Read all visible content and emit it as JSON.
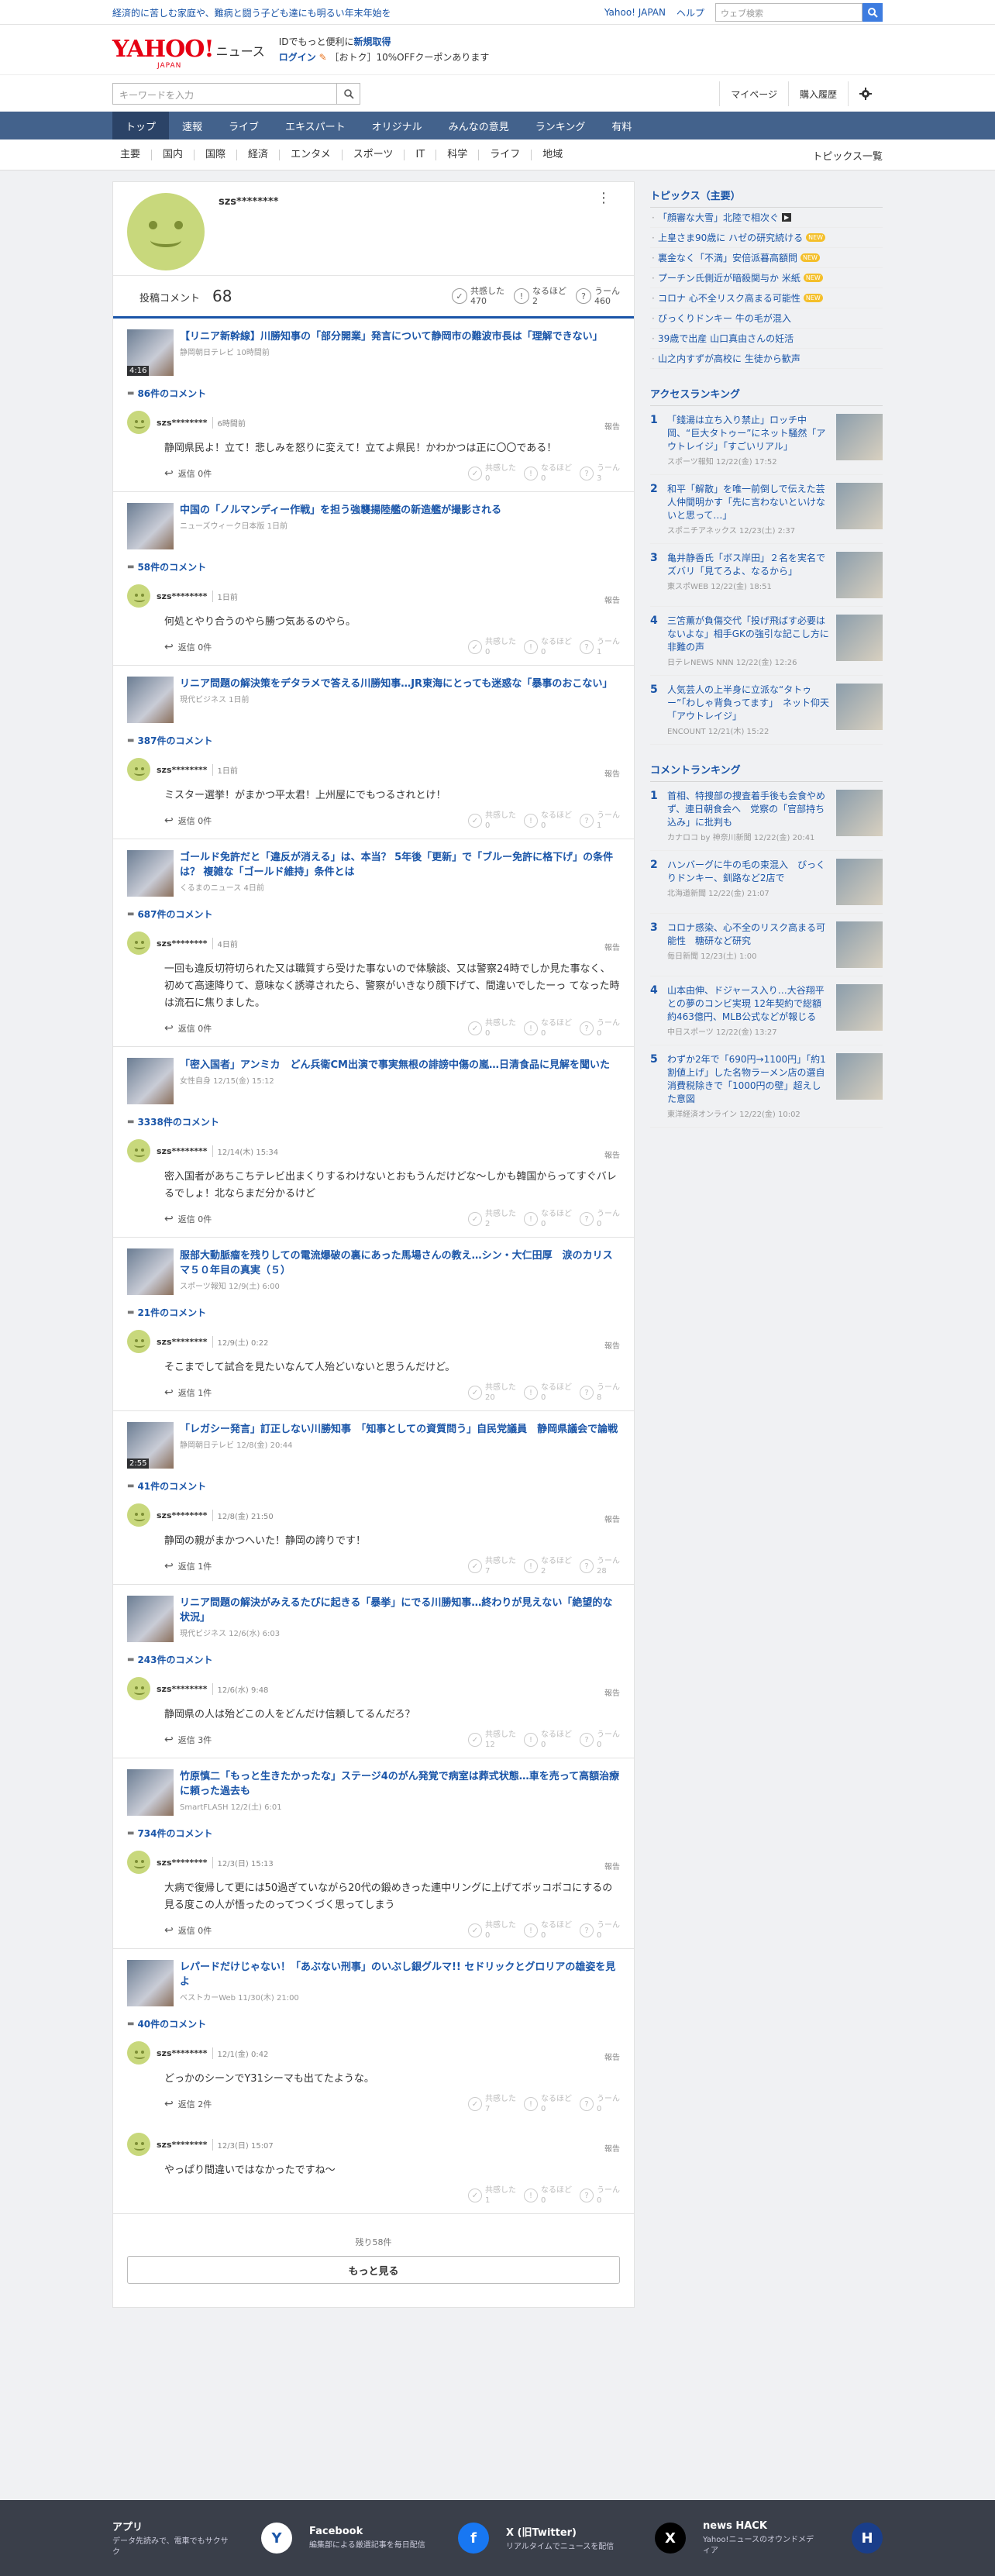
{
  "topbar": {
    "promo": "経済的に苦しむ家庭や、難病と闘う子ども達にも明るい年末年始を",
    "yahoo_japan": "Yahoo! JAPAN",
    "help": "ヘルプ",
    "search_placeholder": "ウェブ検索"
  },
  "header": {
    "logo": "YAHOO!",
    "logo_sub": "JAPAN",
    "logo_news": "ニュース",
    "login_promo_1": "IDでもっと便利に",
    "login_promo_1_link": "新規取得",
    "login_promo_2_link": "ログイン",
    "login_promo_2": "［おトク］10%OFFクーポンあります"
  },
  "searchrow": {
    "placeholder": "キーワードを入力",
    "mypage": "マイページ",
    "subscription": "購入履歴"
  },
  "nav": {
    "tabs": [
      "トップ",
      "速報",
      "ライブ",
      "エキスパート",
      "オリジナル",
      "みんなの意見",
      "ランキング",
      "有料"
    ]
  },
  "subnav": {
    "items": [
      "主要",
      "国内",
      "国際",
      "経済",
      "エンタメ",
      "スポーツ",
      "IT",
      "科学",
      "ライフ",
      "地域"
    ],
    "all": "トピックス一覧"
  },
  "profile": {
    "name": "szs********",
    "post_label": "投稿コメント",
    "post_count": "68",
    "reacts": [
      {
        "label": "共感した",
        "count": "470",
        "icon": "✓"
      },
      {
        "label": "なるほど",
        "count": "2",
        "icon": "!"
      },
      {
        "label": "うーん",
        "count": "460",
        "icon": "?"
      }
    ]
  },
  "articles": [
    {
      "title": "【リニア新幹線】川勝知事の「部分開業」発言について静岡市の難波市長は「理解できない」",
      "source": "静岡朝日テレビ 10時間前",
      "duration": "4:16",
      "comments": "86件のコメント",
      "items": [
        {
          "user": "szs********",
          "time": "6時間前",
          "body": "静岡県民よ！立て！悲しみを怒りに変えて！立てよ県民！かわかつは正に〇〇である！",
          "reply": "返信 0件",
          "r": [
            "0",
            "0",
            "3"
          ]
        }
      ]
    },
    {
      "title": "中国の「ノルマンディー作戦」を担う強襲揚陸艦の新造艦が撮影される",
      "source": "ニューズウィーク日本版 1日前",
      "duration": "",
      "comments": "58件のコメント",
      "items": [
        {
          "user": "szs********",
          "time": "1日前",
          "body": "何処とやり合うのやら勝つ気あるのやら。",
          "reply": "返信 0件",
          "r": [
            "0",
            "0",
            "1"
          ]
        }
      ]
    },
    {
      "title": "リニア問題の解決策をデタラメで答える川勝知事…JR東海にとっても迷惑な「暴事のおこない」",
      "source": "現代ビジネス 1日前",
      "duration": "",
      "comments": "387件のコメント",
      "items": [
        {
          "user": "szs********",
          "time": "1日前",
          "body": "ミスター選挙！がまかつ平太君！上州屋にでもつるされとけ！",
          "reply": "返信 0件",
          "r": [
            "0",
            "0",
            "1"
          ]
        }
      ]
    },
    {
      "title": "ゴールド免許だと「違反が消える」は、本当？ 5年後「更新」で「ブルー免許に格下げ」の条件は？ 複雑な「ゴールド維持」条件とは",
      "source": "くるまのニュース 4日前",
      "duration": "",
      "comments": "687件のコメント",
      "items": [
        {
          "user": "szs********",
          "time": "4日前",
          "body": "一回も違反切符切られた又は職質すら受けた事ないので体験談、又は警察24時でしか見た事なく、初めて高速降りて、意味なく誘導されたら、警察がいきなり顔下げて、間違いでしたーっ てなった時は流石に焦りました。",
          "reply": "返信 0件",
          "r": [
            "0",
            "0",
            "0"
          ]
        }
      ]
    },
    {
      "title": "「密入国者」アンミカ　どん兵衛CM出演で事実無根の誹謗中傷の嵐…日清食品に見解を聞いた",
      "source": "女性自身 12/15(金) 15:12",
      "duration": "",
      "comments": "3338件のコメント",
      "items": [
        {
          "user": "szs********",
          "time": "12/14(木) 15:34",
          "body": "密入国者があちこちテレビ出まくりするわけないとおもうんだけどな〜しかも韓国からってすぐバレるでしょ！北ならまだ分かるけど",
          "reply": "返信 0件",
          "r": [
            "2",
            "0",
            "0"
          ]
        }
      ]
    },
    {
      "title": "服部大動脈瘤を残りしての電流爆破の裏にあった馬場さんの教え…シン・大仁田厚　涙のカリスマ５０年目の真実（５）",
      "source": "スポーツ報知 12/9(土) 6:00",
      "duration": "",
      "comments": "21件のコメント",
      "items": [
        {
          "user": "szs********",
          "time": "12/9(土) 0:22",
          "body": "そこまでして試合を見たいなんて人殆どいないと思うんだけど。",
          "reply": "返信 1件",
          "r": [
            "20",
            "0",
            "8"
          ]
        }
      ]
    },
    {
      "title": "「レガシー発言」訂正しない川勝知事　「知事としての資質問う」自民党議員　静岡県議会で論戦",
      "source": "静岡朝日テレビ 12/8(金) 20:44",
      "duration": "2:55",
      "comments": "41件のコメント",
      "items": [
        {
          "user": "szs********",
          "time": "12/8(金) 21:50",
          "body": "静岡の親がまかつへいた！静岡の誇りです！",
          "reply": "返信 1件",
          "r": [
            "7",
            "2",
            "28"
          ]
        }
      ]
    },
    {
      "title": "リニア問題の解決がみえるたびに起きる「暴挙」にでる川勝知事…終わりが見えない「絶望的な状況」",
      "source": "現代ビジネス 12/6(水) 6:03",
      "duration": "",
      "comments": "243件のコメント",
      "items": [
        {
          "user": "szs********",
          "time": "12/6(水) 9:48",
          "body": "静岡県の人は殆どこの人をどんだけ信頼してるんだろ？",
          "reply": "返信 3件",
          "r": [
            "12",
            "0",
            "0"
          ]
        }
      ]
    },
    {
      "title": "竹原慎二「もっと生きたかったな」ステージ4のがん発覚で病室は葬式状態…車を売って高額治療に頼った過去も",
      "source": "SmartFLASH 12/2(土) 6:01",
      "duration": "",
      "comments": "734件のコメント",
      "items": [
        {
          "user": "szs********",
          "time": "12/3(日) 15:13",
          "body": "大病で復帰して更には50過ぎていながら20代の鍛めきった連中リングに上げてボッコボコにするの見る度この人が悟ったのってつくづく思ってしまう",
          "reply": "返信 0件",
          "r": [
            "0",
            "0",
            "0"
          ]
        }
      ]
    },
    {
      "title": "レパードだけじゃない！「あぶない刑事」のいぶし銀グルマ!! セドリックとグロリアの雄姿を見よ",
      "source": "ベストカーWeb 11/30(木) 21:00",
      "duration": "",
      "comments": "40件のコメント",
      "items": [
        {
          "user": "szs********",
          "time": "12/1(金) 0:42",
          "body": "どっかのシーンでY31シーマも出てたような。",
          "reply": "返信 2件",
          "r": [
            "7",
            "0",
            "0"
          ]
        },
        {
          "user": "szs********",
          "time": "12/3(日) 15:07",
          "body": "やっぱり間違いではなかったですね〜",
          "reply": "",
          "r": [
            "1",
            "0",
            "0"
          ]
        }
      ]
    }
  ],
  "r_labels": [
    "共感した",
    "なるほど",
    "うーん"
  ],
  "report": "報告",
  "remain": "残り58件",
  "more": "もっと見る",
  "topics": {
    "title": "トピックス（主要）",
    "items": [
      {
        "t": "「顔審な大雪」北陸で相次ぐ",
        "badge": "vid"
      },
      {
        "t": "上皇さま90歳に ハゼの研究続ける",
        "badge": "new"
      },
      {
        "t": "裏金なく「不満」安倍派暮高額問",
        "badge": "new"
      },
      {
        "t": "プーチン氏側近が暗殺関与か 米紙",
        "badge": "new"
      },
      {
        "t": "コロナ 心不全リスク高まる可能性",
        "badge": "new"
      },
      {
        "t": "びっくりドンキー 牛の毛が混入",
        "badge": ""
      },
      {
        "t": "39歳で出産 山口真由さんの妊活",
        "badge": ""
      },
      {
        "t": "山之内すずが高校に 生徒から歓声",
        "badge": ""
      }
    ]
  },
  "access": {
    "title": "アクセスランキング",
    "items": [
      {
        "t": "「錢湯は立ち入り禁止」ロッチ中岡、“巨大タトゥー”にネット騒然「アウトレイジ」「すごいリアル」",
        "s": "スポーツ報知 12/22(金) 17:52"
      },
      {
        "t": "和平「解散」を唯一前倒しで伝えた芸人仲間明かす「先に言わないといけないと思って…」",
        "s": "スポニチアネックス 12/23(土) 2:37"
      },
      {
        "t": "亀井静香氏「ボス岸田」２名を実名でズバリ「見てろよ、なるから」",
        "s": "東スポWEB 12/22(金) 18:51"
      },
      {
        "t": "三笘薫が負傷交代「投げ飛ばす必要はないよな」相手GKの強引な記こし方に非難の声",
        "s": "日テレNEWS NNN 12/22(金) 12:26"
      },
      {
        "t": "人気芸人の上半身に立派な“タトゥー”「わしゃ背負ってます」　ネット仰天「アウトレイジ」",
        "s": "ENCOUNT 12/21(木) 15:22"
      }
    ]
  },
  "commentrank": {
    "title": "コメントランキング",
    "items": [
      {
        "t": "首相、特捜部の捜査着手後も会食やめず、連日朝食会へ　党察の「官部持ち込み」に批判も",
        "s": "カナロコ by 神奈川新聞 12/22(金) 20:41"
      },
      {
        "t": "ハンバーグに牛の毛の束混入　びっくりドンキー、釧路など2店で",
        "s": "北海道新聞 12/22(金) 21:07"
      },
      {
        "t": "コロナ感染、心不全のリスク高まる可能性　糖研など研究",
        "s": "毎日新聞 12/23(土) 1:00"
      },
      {
        "t": "山本由伸、ドジャース入り…大谷翔平との夢のコンビ実現 12年契約で総額約463億円、MLB公式などが報じる",
        "s": "中日スポーツ 12/22(金) 13:27"
      },
      {
        "t": "わずか2年で「690円→1100円」「約1割値上げ」した名物ラーメン店の選自　消費税除きで「1000円の壁」超えした意図",
        "s": "東洋経済オンライン 12/22(金) 10:02"
      }
    ]
  },
  "footer": [
    {
      "t": "アプリ",
      "d": "データ先読みで、電車でもサクサク",
      "icon": "app-icon"
    },
    {
      "t": "Facebook",
      "d": "編集部による厳選記事を毎日配信",
      "icon": "facebook-icon"
    },
    {
      "t": "X (旧Twitter)",
      "d": "リアルタイムでニュースを配信",
      "icon": "x-icon"
    },
    {
      "t": "news HACK",
      "d": "Yahoo!ニュースのオウンドメディア",
      "icon": "newshack-icon"
    }
  ],
  "colors": {
    "accent": "#1a55a8",
    "nav": "#43628c",
    "brand": "#e60013",
    "avatar": "#c8d87c"
  }
}
